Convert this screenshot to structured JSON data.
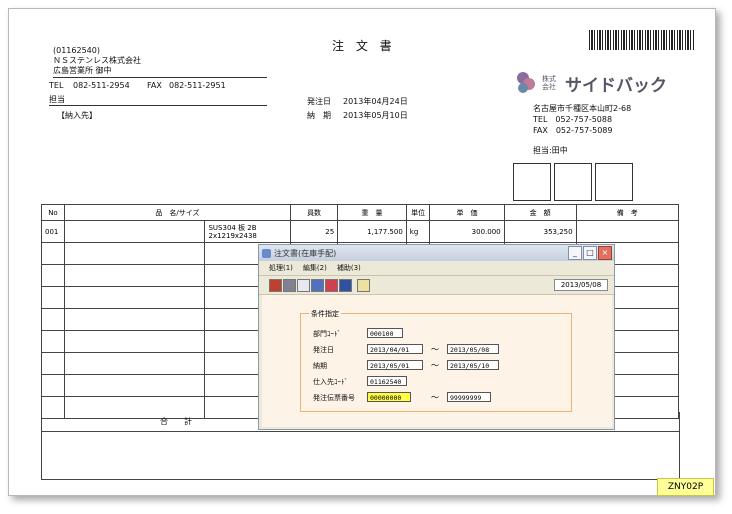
{
  "doc": {
    "title": "注 文 書",
    "customer_code": "(01162540)",
    "customer_name": "ＮＳステンレス株式会社",
    "branch": "広島営業所 御中",
    "tel_label": "TEL",
    "tel": "082-511-2954",
    "fax_label": "FAX",
    "fax": "082-511-2951",
    "person_label": "担当",
    "delivery_label": "【納入先】",
    "order_date_label": "発注日",
    "order_date": "2013年04月24日",
    "deadline_label": "納　期",
    "deadline": "2013年05月10日"
  },
  "company": {
    "logo_small": "株式会社",
    "logo_name": "サイドバック",
    "address": "名古屋市千種区本山町2-68",
    "tel": "TEL　052-757-5088",
    "fax": "FAX　052-757-5089",
    "person": "担当:田中"
  },
  "table": {
    "headers": [
      "No",
      "品　名/サイズ",
      "員数",
      "重　量",
      "単位",
      "単　価",
      "金　額",
      "備　考"
    ],
    "row1": {
      "no": "001",
      "item": "SUS304 板 2B",
      "size": "2x1219x2438",
      "qty": "25",
      "weight": "1,177.500",
      "unit": "kg",
      "price": "300.000",
      "amount": "353,250"
    },
    "total_label": "合　　計"
  },
  "window": {
    "title": "注文書(在庫手配)",
    "menu": [
      "処理(1)",
      "編集(2)",
      "補助(3)"
    ],
    "date": "2013/05/08",
    "group_label": "条件指定",
    "fields": {
      "dept_label": "部門ｺｰﾄﾞ",
      "dept": "000100",
      "order_date_label": "発注日",
      "order_from": "2013/04/01",
      "order_to": "2013/05/08",
      "deadline_label": "納期",
      "deadline_from": "2013/05/01",
      "deadline_to": "2013/05/10",
      "supplier_label": "仕入先ｺｰﾄﾞ",
      "supplier": "01162540",
      "slip_label": "発注伝票番号",
      "slip_from": "00000000",
      "slip_to": "99999999"
    },
    "tilde": "～"
  },
  "badge": "ZNY02P",
  "colors": {
    "highlight": "#ffff44",
    "group_border": "#f0b070",
    "logo": "#555566"
  }
}
